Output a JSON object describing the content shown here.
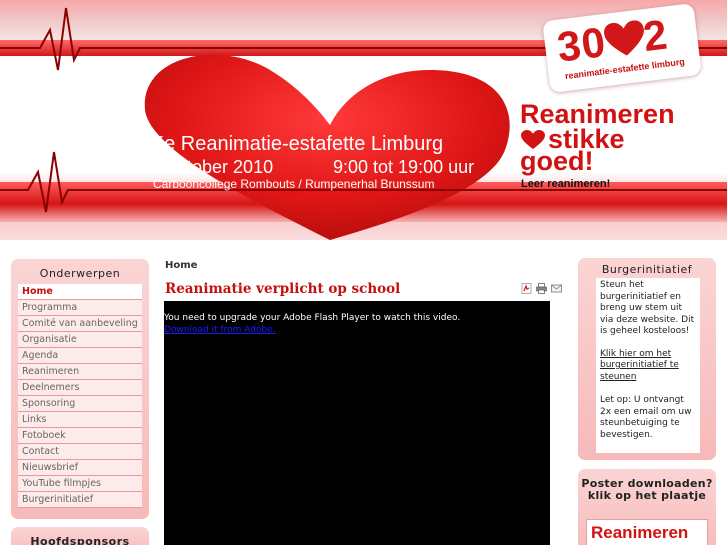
{
  "banner": {
    "event_title": "5e Reanimatie-estafette Limburg",
    "event_date": "1 oktober 2010",
    "event_time": "9:00 tot 19:00 uur",
    "event_venue": "Carbooncollege Rombouts  /  Rumpenerhal Brunssum",
    "logo_number": "30   2",
    "logo_subtitle": "reanimatie-estafette limburg",
    "slogan_line1": "Reanimeren",
    "slogan_line2": "stikke",
    "slogan_line3": "goed!",
    "slogan_line4": "Leer reanimeren!",
    "colors": {
      "brand_red": "#d21212",
      "band_pink": "#f7b9b9"
    }
  },
  "left_sidebar": {
    "title": "Onderwerpen",
    "items": [
      {
        "label": "Home",
        "active": true
      },
      {
        "label": "Programma"
      },
      {
        "label": "Comité van aanbeveling"
      },
      {
        "label": "Organisatie"
      },
      {
        "label": "Agenda"
      },
      {
        "label": "Reanimeren"
      },
      {
        "label": "Deelnemers"
      },
      {
        "label": "Sponsoring"
      },
      {
        "label": "Links"
      },
      {
        "label": "Fotoboek"
      },
      {
        "label": "Contact"
      },
      {
        "label": "Nieuwsbrief"
      },
      {
        "label": "YouTube filmpjes"
      },
      {
        "label": "Burgerinitiatief"
      }
    ],
    "sponsors_title": "Hoofdsponsors"
  },
  "main": {
    "breadcrumb": "Home",
    "article_title": "Reanimatie verplicht op school",
    "icons": [
      "pdf-icon",
      "print-icon",
      "email-icon"
    ],
    "flash_message": "You need to upgrade your Adobe Flash Player to watch this video.",
    "flash_link": "Download it from Adobe."
  },
  "right_sidebar": {
    "burger_title": "Burgerinitiatief",
    "burger_text": "Steun het burgerinitiatief en breng uw stem uit via deze website. Dit is geheel kosteloos!",
    "burger_link": "Klik hier om het burgerinitiatief te steunen",
    "burger_note": "Let op: U ontvangt 2x een email om uw steunbetuiging te bevestigen.",
    "poster_title": "Poster downloaden? klik op het plaatje",
    "poster_thumb_text": "Reanimeren"
  }
}
